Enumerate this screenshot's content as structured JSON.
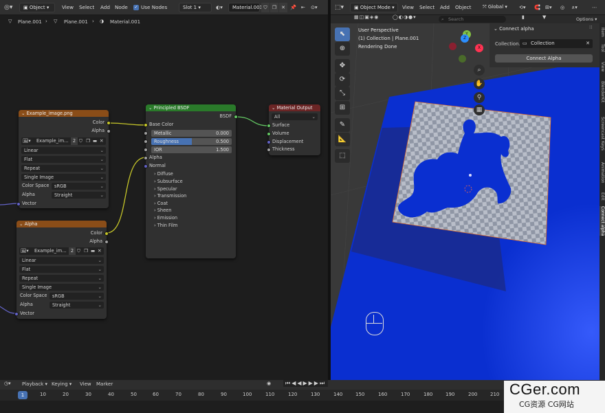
{
  "header_left": {
    "editor_icon": "node-editor-icon",
    "mode": "Object",
    "menus": [
      "View",
      "Select",
      "Add",
      "Node"
    ],
    "use_nodes_label": "Use Nodes",
    "slot": "Slot 1",
    "material": "Material.001"
  },
  "breadcrumb": {
    "items": [
      "Plane.001",
      "Plane.001",
      "Material.001"
    ]
  },
  "header_right": {
    "mode": "Object Mode",
    "menus": [
      "View",
      "Select",
      "Add",
      "Object"
    ],
    "orientation": "Global",
    "search_placeholder": "Search",
    "options_label": "Options"
  },
  "nodes": {
    "image1": {
      "title": "Example_image.png",
      "out_color": "Color",
      "out_alpha": "Alpha",
      "image_name": "Example_im...",
      "users": "2",
      "interpolation": "Linear",
      "projection": "Flat",
      "extension": "Repeat",
      "source": "Single Image",
      "color_space_label": "Color Space",
      "color_space": "sRGB",
      "alpha_label": "Alpha",
      "alpha_mode": "Straight",
      "in_vector": "Vector"
    },
    "image2": {
      "title": "Alpha",
      "out_color": "Color",
      "out_alpha": "Alpha",
      "image_name": "Example_im...",
      "users": "2",
      "interpolation": "Linear",
      "projection": "Flat",
      "extension": "Repeat",
      "source": "Single Image",
      "color_space_label": "Color Space",
      "color_space": "sRGB",
      "alpha_label": "Alpha",
      "alpha_mode": "Straight",
      "in_vector": "Vector"
    },
    "bsdf": {
      "title": "Principled BSDF",
      "out": "BSDF",
      "base_color": "Base Color",
      "metallic_label": "Metallic",
      "metallic": "0.000",
      "roughness_label": "Roughness",
      "roughness": "0.500",
      "roughness_fill": 0.5,
      "ior_label": "IOR",
      "ior": "1.500",
      "alpha": "Alpha",
      "normal": "Normal",
      "panels": [
        "Diffuse",
        "Subsurface",
        "Specular",
        "Transmission",
        "Coat",
        "Sheen",
        "Emission",
        "Thin Film"
      ]
    },
    "output": {
      "title": "Material Output",
      "target": "All",
      "surface": "Surface",
      "volume": "Volume",
      "displacement": "Displacement",
      "thickness": "Thickness"
    }
  },
  "viewport": {
    "title": "User Perspective",
    "collection_line": "(1) Collection | Plane.001",
    "status": "Rendering Done"
  },
  "npanel": {
    "header": "Connect alpha",
    "collection_label": "Collection...",
    "collection_value": "Collection",
    "button": "Connect Alpha",
    "tabs": [
      "Item",
      "Tool",
      "View",
      "BlenderKit",
      "Screencast Keys",
      "Animation",
      "Edit",
      "Connect alpha"
    ]
  },
  "timeline": {
    "menus": [
      "Playback",
      "Keying",
      "View",
      "Marker"
    ],
    "current_frame": "1",
    "frames": [
      "10",
      "20",
      "30",
      "40",
      "50",
      "60",
      "70",
      "80",
      "90",
      "100",
      "110",
      "120",
      "130",
      "140",
      "150",
      "160",
      "170",
      "180",
      "190",
      "200",
      "210"
    ]
  },
  "watermark": {
    "title": "CGer.com",
    "subtitle": "CG资源 CG网站"
  },
  "colors": {
    "image_node_header": "#8a4d18",
    "bsdf_header": "#2a7a2a",
    "output_header": "#6b2525",
    "plane_blue": "#0a2fd0",
    "accent": "#4772b3"
  }
}
